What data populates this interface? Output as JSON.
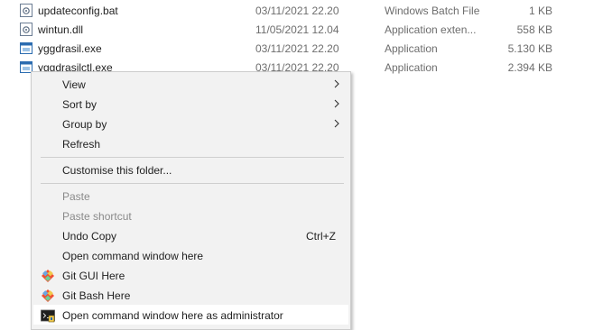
{
  "files": [
    {
      "name": "updateconfig.bat",
      "date": "03/11/2021 22.20",
      "type": "Windows Batch File",
      "size": "1 KB",
      "icon": "batch-file-icon"
    },
    {
      "name": "wintun.dll",
      "date": "11/05/2021 12.04",
      "type": "Application exten...",
      "size": "558 KB",
      "icon": "dll-file-icon"
    },
    {
      "name": "yggdrasil.exe",
      "date": "03/11/2021 22.20",
      "type": "Application",
      "size": "5.130 KB",
      "icon": "exe-file-icon"
    },
    {
      "name": "yggdrasilctl.exe",
      "date": "03/11/2021 22.20",
      "type": "Application",
      "size": "2.394 KB",
      "icon": "exe-file-icon"
    }
  ],
  "context_menu": {
    "items": [
      {
        "label": "View",
        "submenu": true
      },
      {
        "label": "Sort by",
        "submenu": true
      },
      {
        "label": "Group by",
        "submenu": true
      },
      {
        "label": "Refresh"
      },
      {
        "label": "Customise this folder..."
      },
      {
        "label": "Paste",
        "disabled": true
      },
      {
        "label": "Paste shortcut",
        "disabled": true
      },
      {
        "label": "Undo Copy",
        "shortcut": "Ctrl+Z"
      },
      {
        "label": "Open command window here"
      },
      {
        "label": "Git GUI Here",
        "icon": "git-icon"
      },
      {
        "label": "Git Bash Here",
        "icon": "git-icon"
      },
      {
        "label": "Open command window here as administrator",
        "icon": "command-prompt-icon",
        "highlighted": true
      }
    ]
  },
  "colors": {
    "menu_background": "#f2f2f2",
    "disabled_text": "#8a8a8a",
    "secondary_text": "#6d6d6d"
  }
}
